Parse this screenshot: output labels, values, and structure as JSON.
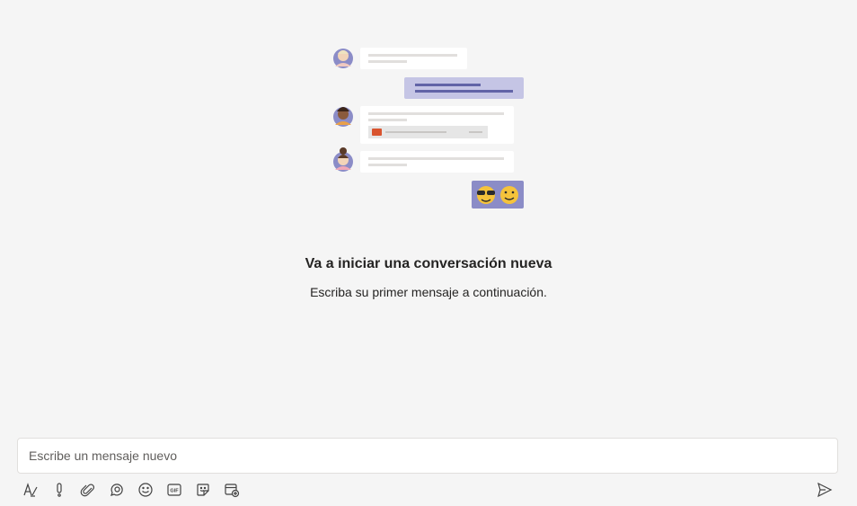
{
  "empty_state": {
    "title": "Va a iniciar una conversación nueva",
    "subtitle": "Escriba su primer mensaje a continuación."
  },
  "composer": {
    "placeholder": "Escribe un mensaje nuevo",
    "value": ""
  },
  "toolbar": {
    "tools": [
      "format-icon",
      "important-icon",
      "attach-icon",
      "loop-icon",
      "emoji-icon",
      "gif-icon",
      "sticker-icon",
      "schedule-meeting-icon"
    ],
    "send_icon": "send-icon"
  },
  "colors": {
    "background": "#f5f5f5",
    "accent": "#6264a7",
    "accent_light": "#c5c5e5"
  }
}
